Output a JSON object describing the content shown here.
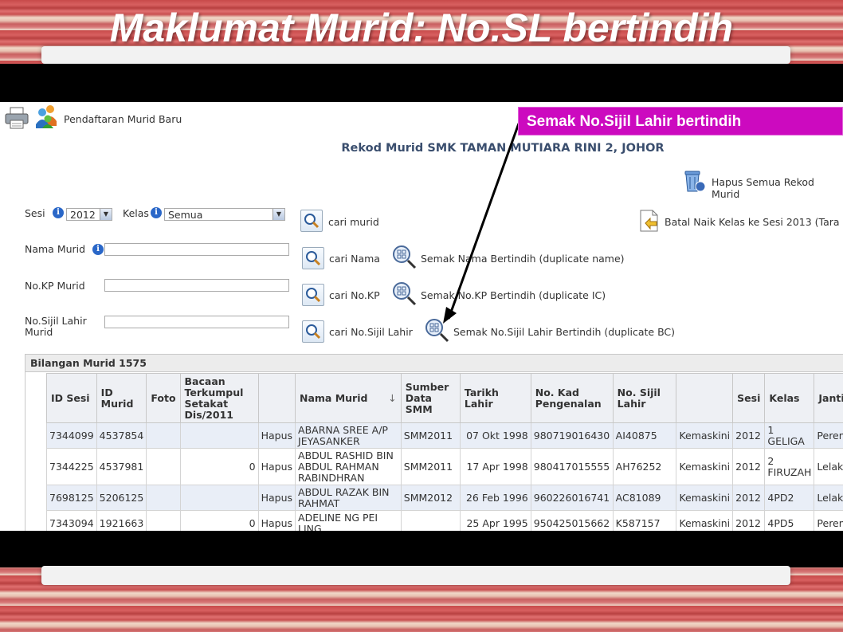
{
  "slide": {
    "title": "Maklumat Murid: No.SL bertindih",
    "callout": "Semak No.Sijil Lahir bertindih"
  },
  "app": {
    "nav_label": "Pendaftaran Murid Baru",
    "heading": "Rekod Murid SMK TAMAN MUTIARA RINI 2, JOHOR",
    "hapus_semua": "Hapus Semua Rekod Murid",
    "batal_naik": "Batal Naik Kelas ke Sesi 2013 (Tara"
  },
  "form": {
    "sesi_label": "Sesi",
    "sesi_value": "2012",
    "kelas_label": "Kelas",
    "kelas_value": "Semua",
    "nama_label": "Nama Murid",
    "kp_label": "No.KP Murid",
    "sijil_label_1": "No.Sijil Lahir",
    "sijil_label_2": "Murid",
    "cari_murid": "cari murid",
    "cari_nama": "cari Nama",
    "cari_kp": "cari No.KP",
    "cari_sijil": "cari No.Sijil Lahir",
    "semak_nama": "Semak Nama Bertindih (duplicate name)",
    "semak_kp": "Semak No.KP Bertindih (duplicate IC)",
    "semak_sijil": "Semak No.Sijil Lahir Bertindih (duplicate BC)"
  },
  "table": {
    "caption": "Bilangan Murid 1575",
    "headers": {
      "id_sesi": "ID Sesi",
      "id_murid_1": "ID",
      "id_murid_2": "Murid",
      "foto": "Foto",
      "bacaan_1": "Bacaan",
      "bacaan_2": "Terkumpul",
      "bacaan_3": "Setakat",
      "bacaan_4": "Dis/2011",
      "nama": "Nama Murid",
      "sort_icon": "↓",
      "sumber_1": "Sumber",
      "sumber_2": "Data",
      "sumber_3": "SMM",
      "tarikh": "Tarikh Lahir",
      "nokad_1": "No. Kad",
      "nokad_2": "Pengenalan",
      "sijil_1": "No. Sijil",
      "sijil_2": "Lahir",
      "sesi": "Sesi",
      "kelas": "Kelas",
      "jantina": "Janti"
    },
    "rows": [
      {
        "id_sesi": "7344099",
        "id_murid": "4537854",
        "bacaan": "",
        "hapus": "Hapus",
        "nama_1": "ABARNA SREE A/P",
        "nama_2": "JEYASANKER",
        "nama_3": "",
        "sumber": "SMM2011",
        "tarikh": "07 Okt 1998",
        "ic": "980719016430",
        "sijil": "AI40875",
        "kemaskini": "Kemaskini",
        "sesi": "2012",
        "kelas_1": "1",
        "kelas_2": "GELIGA",
        "jantina": "Perem"
      },
      {
        "id_sesi": "7344225",
        "id_murid": "4537981",
        "bacaan": "0",
        "hapus": "Hapus",
        "nama_1": "ABDUL RASHID BIN",
        "nama_2": "ABDUL RAHMAN",
        "nama_3": "RABINDHRAN",
        "sumber": "SMM2011",
        "tarikh": "17 Apr 1998",
        "ic": "980417015555",
        "sijil": "AH76252",
        "kemaskini": "Kemaskini",
        "sesi": "2012",
        "kelas_1": "2",
        "kelas_2": "FIRUZAH",
        "jantina": "Lelaki"
      },
      {
        "id_sesi": "7698125",
        "id_murid": "5206125",
        "bacaan": "",
        "hapus": "Hapus",
        "nama_1": "ABDUL RAZAK BIN",
        "nama_2": "RAHMAT",
        "nama_3": "",
        "sumber": "SMM2012",
        "tarikh": "26 Feb 1996",
        "ic": "960226016741",
        "sijil": "AC81089",
        "kemaskini": "Kemaskini",
        "sesi": "2012",
        "kelas_1": "4PD2",
        "kelas_2": "",
        "jantina": "Lelaki"
      },
      {
        "id_sesi": "7343094",
        "id_murid": "1921663",
        "bacaan": "0",
        "hapus": "Hapus",
        "nama_1": "ADELINE NG PEI",
        "nama_2": "LING",
        "nama_3": "",
        "sumber": "",
        "tarikh": "25 Apr 1995",
        "ic": "950425015662",
        "sijil": "K587157",
        "kemaskini": "Kemaskini",
        "sesi": "2012",
        "kelas_1": "4PD5",
        "kelas_2": "",
        "jantina": "Perem"
      }
    ]
  }
}
